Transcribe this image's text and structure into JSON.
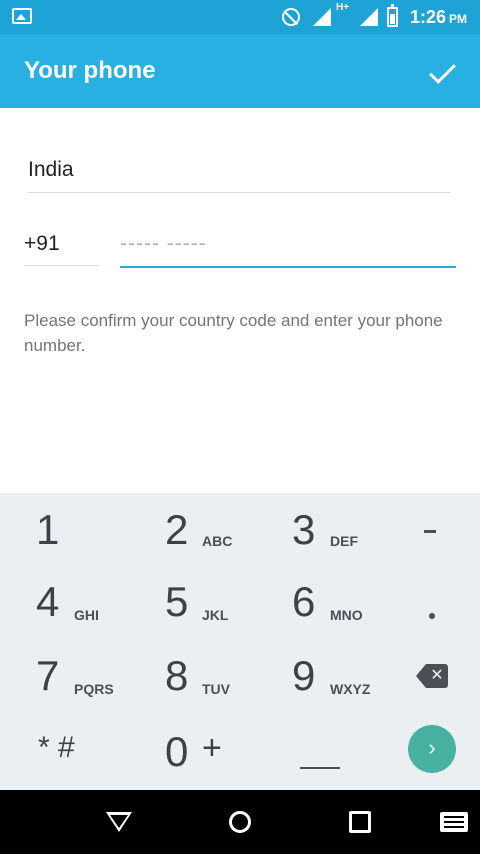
{
  "status_bar": {
    "time": "1:26",
    "ampm": "PM",
    "data_indicator": "H+"
  },
  "app_bar": {
    "title": "Your phone",
    "confirm_icon": "check-icon"
  },
  "form": {
    "country": "India",
    "country_code": "+91",
    "phone_placeholder": "----- -----",
    "hint": "Please confirm your country code and enter your phone number."
  },
  "keypad": {
    "keys": [
      {
        "digit": "1",
        "letters": ""
      },
      {
        "digit": "2",
        "letters": "ABC"
      },
      {
        "digit": "3",
        "letters": "DEF"
      },
      {
        "digit": "4",
        "letters": "GHI"
      },
      {
        "digit": "5",
        "letters": "JKL"
      },
      {
        "digit": "6",
        "letters": "MNO"
      },
      {
        "digit": "7",
        "letters": "PQRS"
      },
      {
        "digit": "8",
        "letters": "TUV"
      },
      {
        "digit": "9",
        "letters": "WXYZ"
      },
      {
        "digit": "0",
        "letters": "+"
      }
    ],
    "star_hash": "* #",
    "side_keys": [
      "-",
      ".",
      "backspace",
      "go"
    ]
  },
  "colors": {
    "status_bar": "#1ea3d6",
    "app_bar": "#27b0e1",
    "accent_underline": "#2aa9d8",
    "go_button": "#47b2a0",
    "keypad_bg": "#eceff1"
  }
}
